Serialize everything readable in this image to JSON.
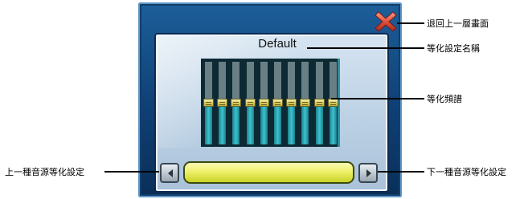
{
  "screen": {
    "preset_name": "Default"
  },
  "equalizer": {
    "band_count": 10,
    "levels": [
      0.5,
      0.5,
      0.5,
      0.5,
      0.5,
      0.5,
      0.5,
      0.5,
      0.5,
      0.5
    ]
  },
  "icons": {
    "close": "close-icon",
    "prev": "chevron-left-icon",
    "next": "chevron-right-icon"
  },
  "colors": {
    "frame": "#0e3f74",
    "close": "#e0523f",
    "preset_bar": "#eef06a",
    "eq_band": "#3cc3cf"
  },
  "annotations": {
    "close": "退回上一層畫面",
    "preset_name": "等化設定名稱",
    "spectrum": "等化頻譜",
    "prev_preset": "上一種音源等化設定",
    "next_preset": "下一種音源等化設定"
  }
}
